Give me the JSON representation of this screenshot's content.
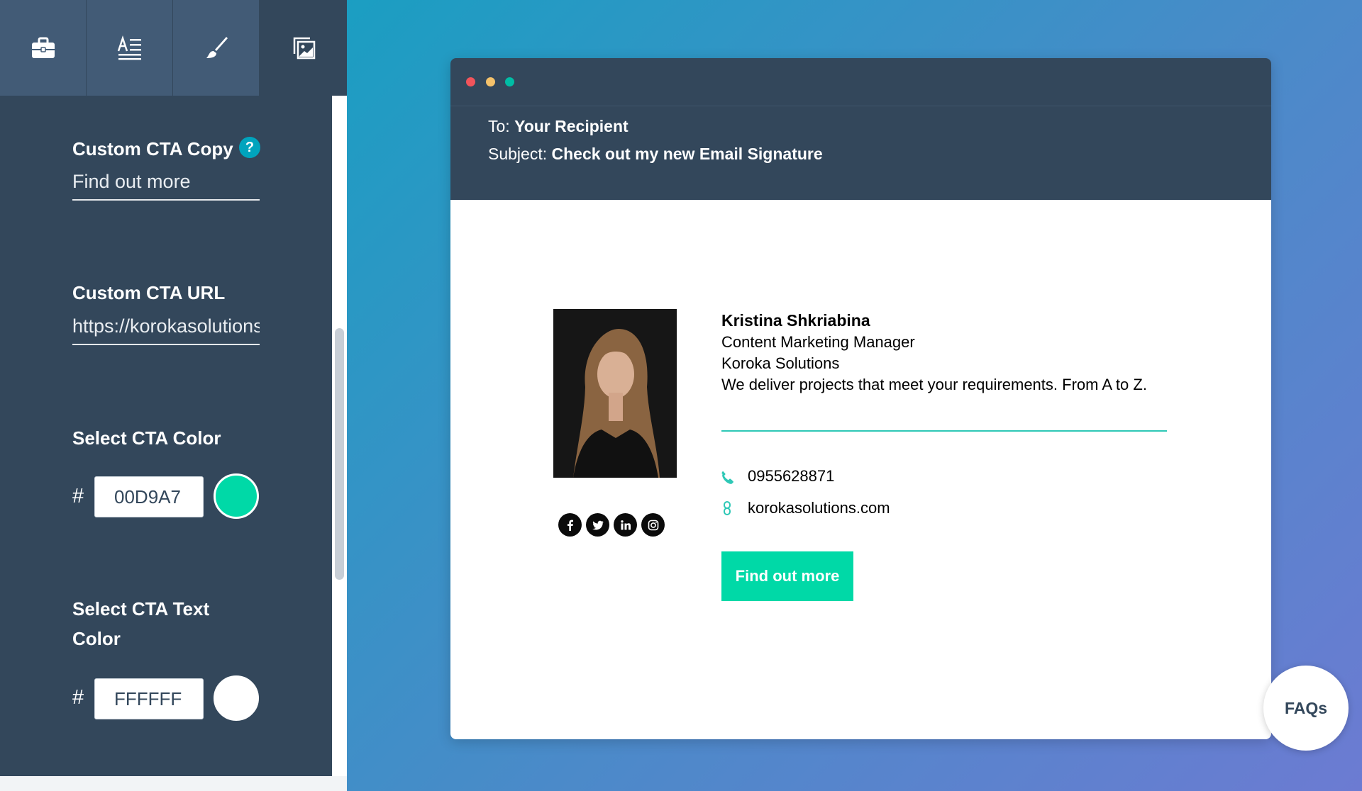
{
  "sidebar": {
    "tabs": [
      {
        "icon": "briefcase-icon"
      },
      {
        "icon": "text-format-icon"
      },
      {
        "icon": "paintbrush-icon"
      },
      {
        "icon": "image-gallery-icon"
      }
    ],
    "cta_copy": {
      "label": "Custom CTA Copy",
      "help": "?",
      "value": "Find out more"
    },
    "cta_url": {
      "label": "Custom CTA URL",
      "value": "https://korokasolutions.com"
    },
    "cta_color": {
      "label": "Select CTA Color",
      "hash": "#",
      "value": "00D9A7",
      "swatch": "#00D9A7"
    },
    "cta_text_color": {
      "label_line1": "Select CTA Text",
      "label_line2": "Color",
      "hash": "#",
      "value": "FFFFFF",
      "swatch": "#FFFFFF"
    }
  },
  "email": {
    "to_label": "To:",
    "to_value": "Your Recipient",
    "subject_label": "Subject:",
    "subject_value": "Check out my new Email Signature",
    "signature": {
      "name": "Kristina Shkriabina",
      "title": "Content Marketing Manager",
      "company": "Koroka Solutions",
      "tagline": "We deliver projects that meet your requirements. From A to Z.",
      "phone": "0955628871",
      "website": "korokasolutions.com",
      "cta": "Find out more",
      "socials": [
        "facebook-icon",
        "twitter-icon",
        "linkedin-icon",
        "instagram-icon"
      ]
    }
  },
  "faq": "FAQs",
  "colors": {
    "panel": "#33475B",
    "tab": "#425B76",
    "accent": "#00D9A7",
    "help_badge": "#00A4BD"
  }
}
